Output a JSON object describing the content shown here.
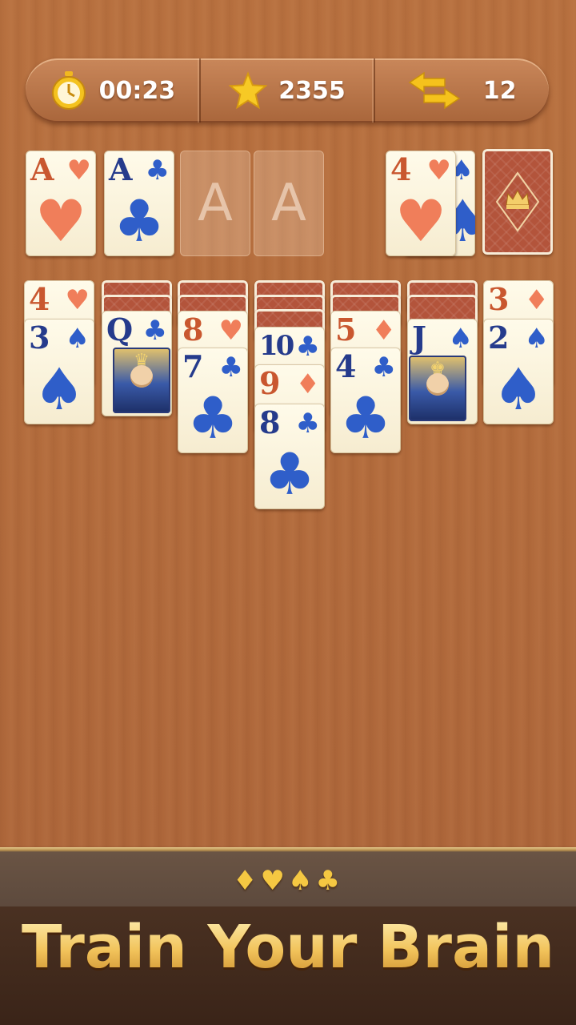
{
  "stats": {
    "timer": "00:23",
    "score": "2355",
    "moves": "12"
  },
  "foundation": [
    {
      "rank": "A",
      "suit": "♥",
      "color": "red"
    },
    {
      "rank": "A",
      "suit": "♣",
      "color": "blue"
    },
    {
      "placeholder": "A"
    },
    {
      "placeholder": "A"
    }
  ],
  "waste": {
    "rank": "4",
    "suit": "♥",
    "color": "red",
    "under_suit": "♠"
  },
  "tableau": [
    {
      "cards": [
        {
          "rank": "4",
          "suit": "♥",
          "color": "red"
        },
        {
          "rank": "3",
          "suit": "♠",
          "color": "blue"
        }
      ]
    },
    {
      "cards": [
        {
          "rank": "Q",
          "suit": "♣",
          "color": "blue",
          "face": true
        }
      ]
    },
    {
      "cards": [
        {
          "rank": "8",
          "suit": "♥",
          "color": "red"
        },
        {
          "rank": "7",
          "suit": "♣",
          "color": "blue"
        }
      ]
    },
    {
      "cards": [
        {
          "rank": "10",
          "suit": "♣",
          "color": "blue"
        },
        {
          "rank": "9",
          "suit": "♦",
          "color": "red"
        },
        {
          "rank": "8",
          "suit": "♣",
          "color": "blue"
        }
      ]
    },
    {
      "cards": [
        {
          "rank": "5",
          "suit": "♦",
          "color": "red"
        },
        {
          "rank": "4",
          "suit": "♣",
          "color": "blue"
        }
      ]
    },
    {
      "cards": [
        {
          "rank": "J",
          "suit": "♠",
          "color": "blue",
          "face": true
        }
      ]
    },
    {
      "cards": [
        {
          "rank": "3",
          "suit": "♦",
          "color": "red"
        },
        {
          "rank": "2",
          "suit": "♠",
          "color": "blue"
        }
      ]
    }
  ],
  "banner": {
    "suits": "♦♥♠♣",
    "tagline": "Train Your Brain"
  },
  "colors": {
    "red_suit": "#f07e5a",
    "blue_suit": "#2f5ec9",
    "card_back": "#b3543b",
    "gold": "#f5c842"
  }
}
